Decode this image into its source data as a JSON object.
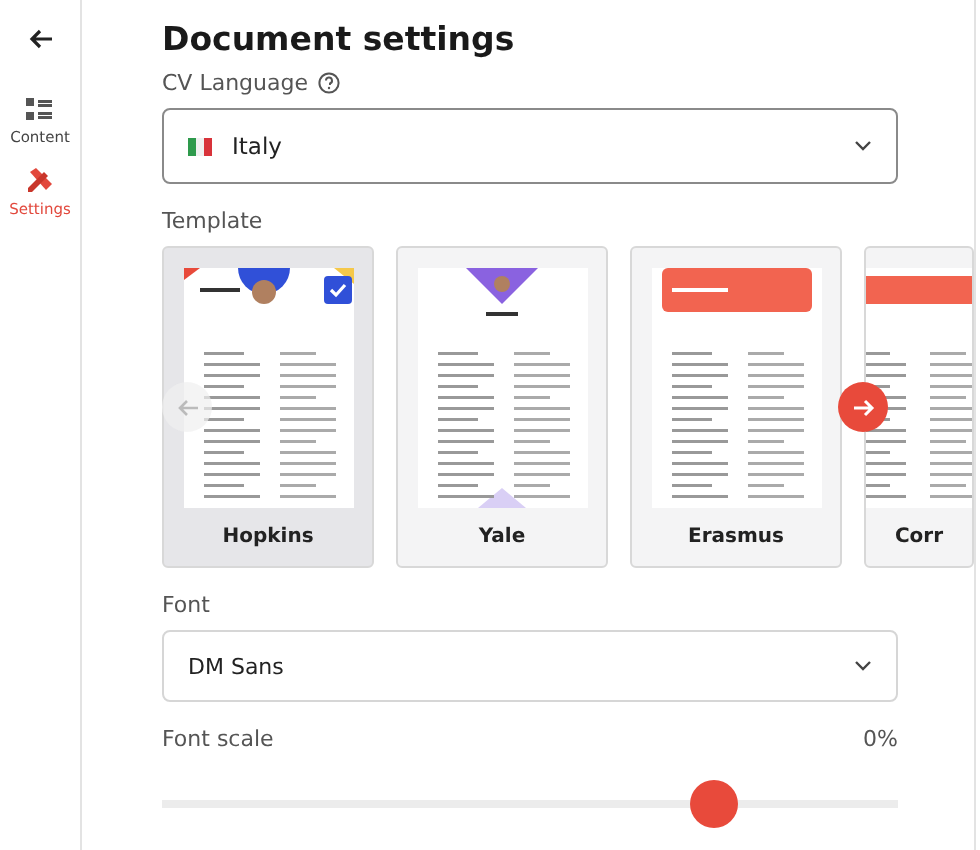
{
  "sidebar": {
    "items": [
      {
        "label": "Content",
        "selected": false
      },
      {
        "label": "Settings",
        "selected": true
      }
    ]
  },
  "title": "Document settings",
  "language": {
    "label": "CV Language",
    "value": "Italy"
  },
  "template": {
    "label": "Template",
    "cards": [
      {
        "name": "Hopkins",
        "selected": true
      },
      {
        "name": "Yale",
        "selected": false
      },
      {
        "name": "Erasmus",
        "selected": false
      },
      {
        "name": "Corr",
        "selected": false
      }
    ]
  },
  "font": {
    "label": "Font",
    "value": "DM Sans"
  },
  "font_scale": {
    "label": "Font scale",
    "reading": "0%",
    "level": 0.75
  }
}
